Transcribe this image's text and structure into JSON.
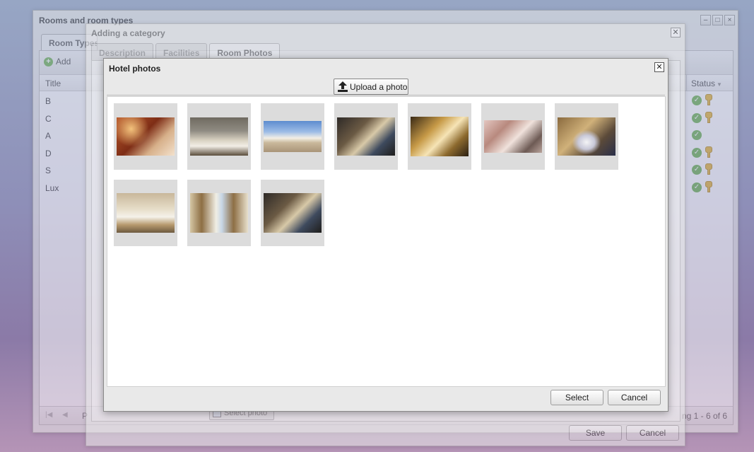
{
  "rooms_window": {
    "title": "Rooms and room types",
    "tab_label": "Room Types",
    "add_label": "Add",
    "columns": {
      "title": "Title",
      "status": "Status"
    },
    "rows": [
      {
        "title": "B",
        "has_key": true
      },
      {
        "title": "C",
        "has_key": true
      },
      {
        "title": "A",
        "has_key": false
      },
      {
        "title": "D",
        "has_key": true
      },
      {
        "title": "S",
        "has_key": true
      },
      {
        "title": "Lux",
        "has_key": true
      }
    ],
    "pager_label": "P",
    "pager_info": "ng 1 - 6 of 6",
    "icons": {
      "status_ok": "check-circle-icon",
      "key": "key-icon"
    }
  },
  "category_window": {
    "title": "Adding a category",
    "tabs": [
      {
        "label": "Description",
        "active": false
      },
      {
        "label": "Facilities",
        "active": false
      },
      {
        "label": "Room Photos",
        "active": true
      }
    ],
    "select_photo_label": "Select photo",
    "save_label": "Save",
    "cancel_label": "Cancel"
  },
  "photos_dialog": {
    "title": "Hotel photos",
    "upload_label": "Upload a photo",
    "select_label": "Select",
    "cancel_label": "Cancel",
    "photos": [
      {
        "name": "hotel-photo-1",
        "subject": "warm-bedroom"
      },
      {
        "name": "hotel-photo-2",
        "subject": "twin-room"
      },
      {
        "name": "hotel-photo-3",
        "subject": "hotel-exterior"
      },
      {
        "name": "hotel-photo-4",
        "subject": "dark-suite"
      },
      {
        "name": "hotel-photo-5",
        "subject": "gold-bedroom"
      },
      {
        "name": "hotel-photo-6",
        "subject": "pink-suite"
      },
      {
        "name": "hotel-photo-7",
        "subject": "round-bed-room"
      },
      {
        "name": "hotel-photo-8",
        "subject": "beige-room"
      },
      {
        "name": "hotel-photo-9",
        "subject": "balcony-room"
      },
      {
        "name": "hotel-photo-10",
        "subject": "dark-suite-2"
      }
    ]
  }
}
